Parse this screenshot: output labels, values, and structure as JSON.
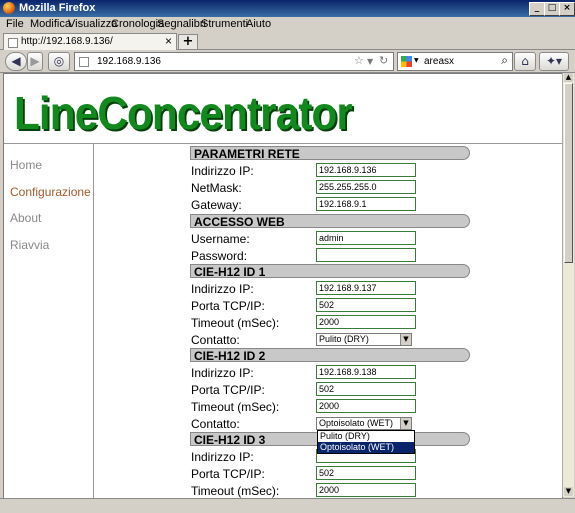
{
  "window": {
    "title": "Mozilla Firefox"
  },
  "menu": [
    "File",
    "Modifica",
    "Visualizza",
    "Cronologia",
    "Segnalibri",
    "Strumenti",
    "Aiuto"
  ],
  "tab": {
    "title": "http://192.168.9.136/",
    "close": "×",
    "new": "+"
  },
  "nav": {
    "url": "192.168.9.136",
    "search_value": "areasx"
  },
  "page": {
    "logo": "LineConcentrator",
    "sidebar": [
      "Home",
      "Configurazione",
      "About",
      "Riavvia"
    ],
    "sections": {
      "rete": "PARAMETRI RETE",
      "web": "ACCESSO WEB",
      "id1": "CIE-H12 ID 1",
      "id2": "CIE-H12 ID 2",
      "id3": "CIE-H12 ID 3"
    },
    "labels": {
      "ip": "Indirizzo IP:",
      "netmask": "NetMask:",
      "gateway": "Gateway:",
      "username": "Username:",
      "password": "Password:",
      "porta": "Porta TCP/IP:",
      "timeout": "Timeout (mSec):",
      "contatto": "Contatto:"
    },
    "rete": {
      "ip": "192.168.9.136",
      "netmask": "255.255.255.0",
      "gateway": "192.168.9.1"
    },
    "web": {
      "username": "admin",
      "password": ""
    },
    "id1": {
      "ip": "192.168.9.137",
      "porta": "502",
      "timeout": "2000",
      "contatto": "Pulito (DRY)"
    },
    "id2": {
      "ip": "192.168.9.138",
      "porta": "502",
      "timeout": "2000",
      "contatto": "Optoisolato (WET)"
    },
    "id3": {
      "ip": "",
      "porta": "502",
      "timeout": "2000"
    },
    "dropdown_options": [
      "Pulito (DRY)",
      "Optoisolato (WET)"
    ]
  }
}
